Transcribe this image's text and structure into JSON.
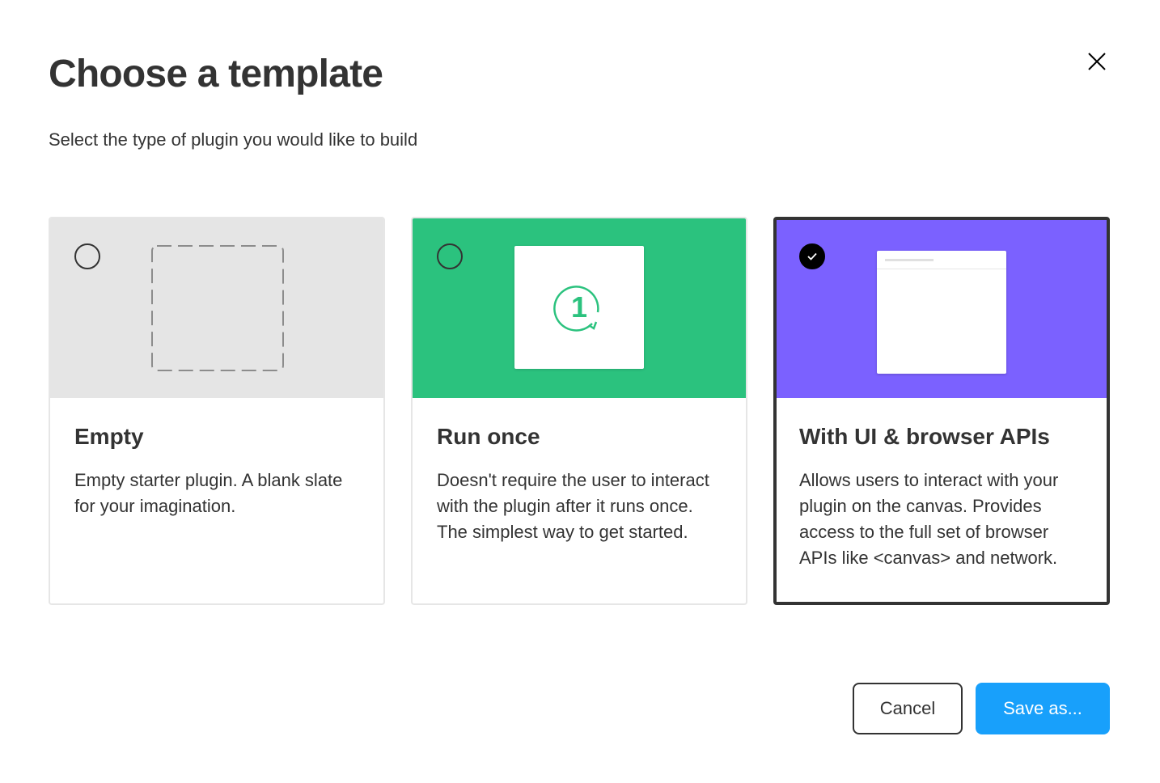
{
  "dialog": {
    "title": "Choose a template",
    "subtitle": "Select the type of plugin you would like to build",
    "close_icon": "close-icon"
  },
  "templates": [
    {
      "title": "Empty",
      "description": "Empty starter plugin. A blank slate for your imagination.",
      "selected": false,
      "hero_color": "#e5e5e5",
      "illustration": "dashed-square-icon"
    },
    {
      "title": "Run once",
      "description": "Doesn't require the user to interact with the plugin after it runs once. The simplest way to get started.",
      "selected": false,
      "hero_color": "#2bc27e",
      "illustration": "run-once-icon",
      "illustration_glyph": "1"
    },
    {
      "title": "With UI & browser APIs",
      "description": "Allows users to interact with your plugin on the canvas. Provides access to the full set of browser APIs like <canvas> and network.",
      "selected": true,
      "hero_color": "#7b61ff",
      "illustration": "window-icon"
    }
  ],
  "footer": {
    "cancel_label": "Cancel",
    "save_label": "Save as..."
  },
  "colors": {
    "text": "#333333",
    "primary": "#18a0fb",
    "border": "#e6e6e6"
  }
}
